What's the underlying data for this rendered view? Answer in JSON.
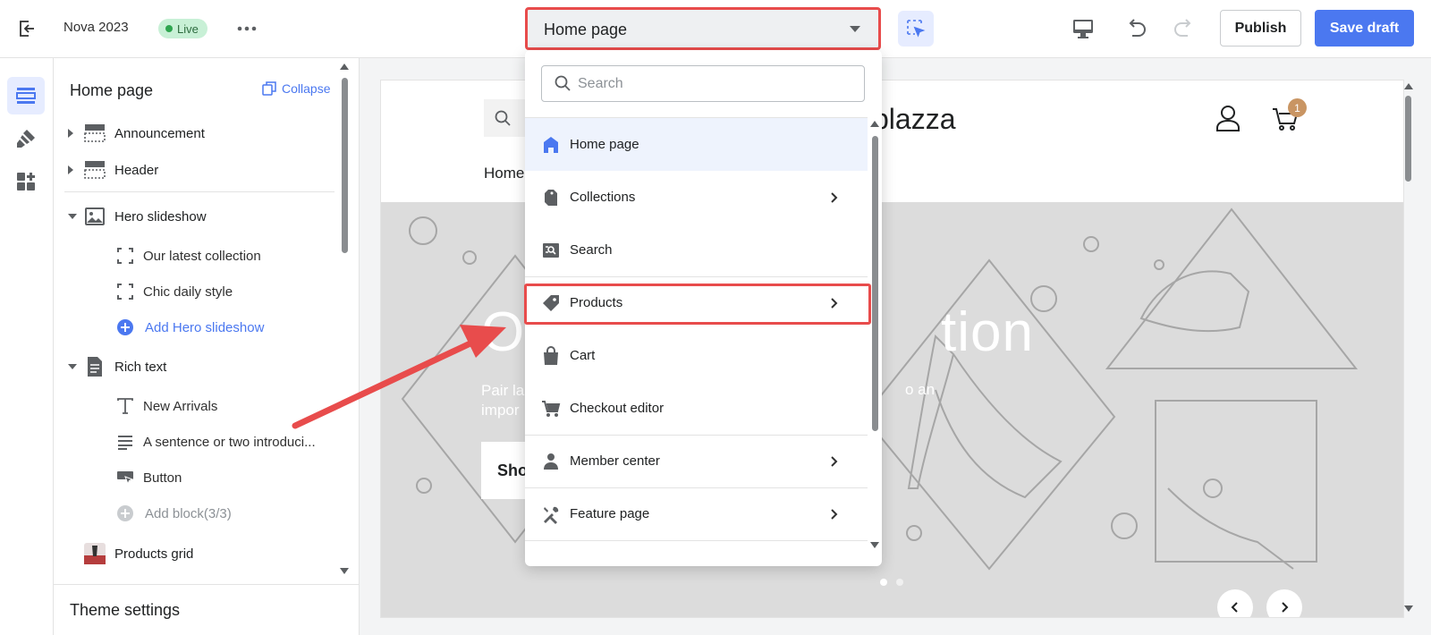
{
  "topbar": {
    "site_name": "Nova 2023",
    "live_badge": "Live",
    "page_selector": "Home page",
    "publish_label": "Publish",
    "save_draft_label": "Save draft",
    "accent_color": "#4b78f0"
  },
  "sidebar": {
    "title": "Home page",
    "collapse_label": "Collapse",
    "sections": [
      {
        "label": "Announcement",
        "icon": "section-layout-icon",
        "expanded": false
      },
      {
        "label": "Header",
        "icon": "section-layout-icon",
        "expanded": false
      },
      {
        "label": "Hero slideshow",
        "icon": "image-icon",
        "expanded": true,
        "blocks": [
          "Our latest collection",
          "Chic daily style"
        ],
        "add_label": "Add Hero slideshow"
      },
      {
        "label": "Rich text",
        "icon": "document-icon",
        "expanded": true,
        "blocks": [
          "New Arrivals",
          "A sentence or two introduci...",
          "Button"
        ],
        "add_label": "Add block(3/3)"
      },
      {
        "label": "Products grid",
        "icon": "product-thumbnail-icon",
        "expanded": false
      }
    ],
    "theme_settings_label": "Theme settings"
  },
  "dropdown": {
    "search_placeholder": "Search",
    "items": [
      {
        "label": "Home page",
        "icon": "home-icon",
        "has_submenu": false,
        "selected": true
      },
      {
        "label": "Collections",
        "icon": "collections-icon",
        "has_submenu": true
      },
      {
        "label": "Search",
        "icon": "search-page-icon",
        "has_submenu": false
      },
      {
        "label": "Products",
        "icon": "tag-icon",
        "has_submenu": true,
        "highlighted": true
      },
      {
        "label": "Cart",
        "icon": "bag-icon",
        "has_submenu": false
      },
      {
        "label": "Checkout editor",
        "icon": "cart-icon",
        "has_submenu": false
      },
      {
        "label": "Member center",
        "icon": "person-icon",
        "has_submenu": true
      },
      {
        "label": "Feature page",
        "icon": "tools-icon",
        "has_submenu": true
      }
    ]
  },
  "preview": {
    "brand": "plazza",
    "nav_home": "Home",
    "cart_count": "1",
    "hero_title_left": "O",
    "hero_title_right": "tion",
    "hero_text": "Pair la",
    "hero_text_line2": "impor",
    "hero_text_right": "o an",
    "hero_button": "Sho"
  }
}
